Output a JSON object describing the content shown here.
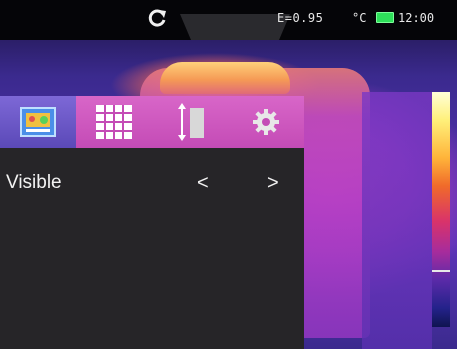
{
  "status_bar": {
    "emissivity": "E=0.95",
    "unit": "°C",
    "time": "12:00",
    "battery_color": "#2ee05a"
  },
  "icons": {
    "refresh": "refresh-icon",
    "image_mode": "image-mode-icon",
    "grid": "grid-icon",
    "range": "range-icon",
    "settings": "gear-icon"
  },
  "menu": {
    "selected_index": 0,
    "accent": "#c44bb6",
    "selected_color": "#5b49b8"
  },
  "setting_row": {
    "label": "Visible",
    "prev": "<",
    "next": ">"
  }
}
